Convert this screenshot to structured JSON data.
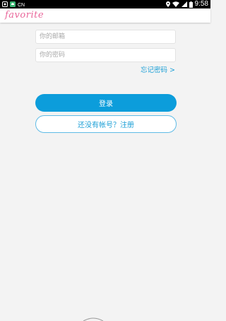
{
  "status_bar": {
    "time": "9:58",
    "left_icons": [
      "notification-app-icon",
      "android-icon",
      "cn-badge"
    ],
    "cn_text": "CN",
    "right_icons": [
      "location-icon",
      "wifi-icon",
      "signal-icon",
      "battery-icon"
    ]
  },
  "app_bar": {
    "title": "favorite",
    "title_color": "#e9669a"
  },
  "login_form": {
    "email_placeholder": "你的邮箱",
    "email_value": "",
    "password_placeholder": "你的密码",
    "password_value": "",
    "forgot_password": "忘记密码 >",
    "login_button": "登录",
    "register_button": "还没有帐号？注册"
  },
  "colors": {
    "accent": "#0c9ddb",
    "link": "#1b9fd6",
    "background": "#f3f3f3"
  }
}
